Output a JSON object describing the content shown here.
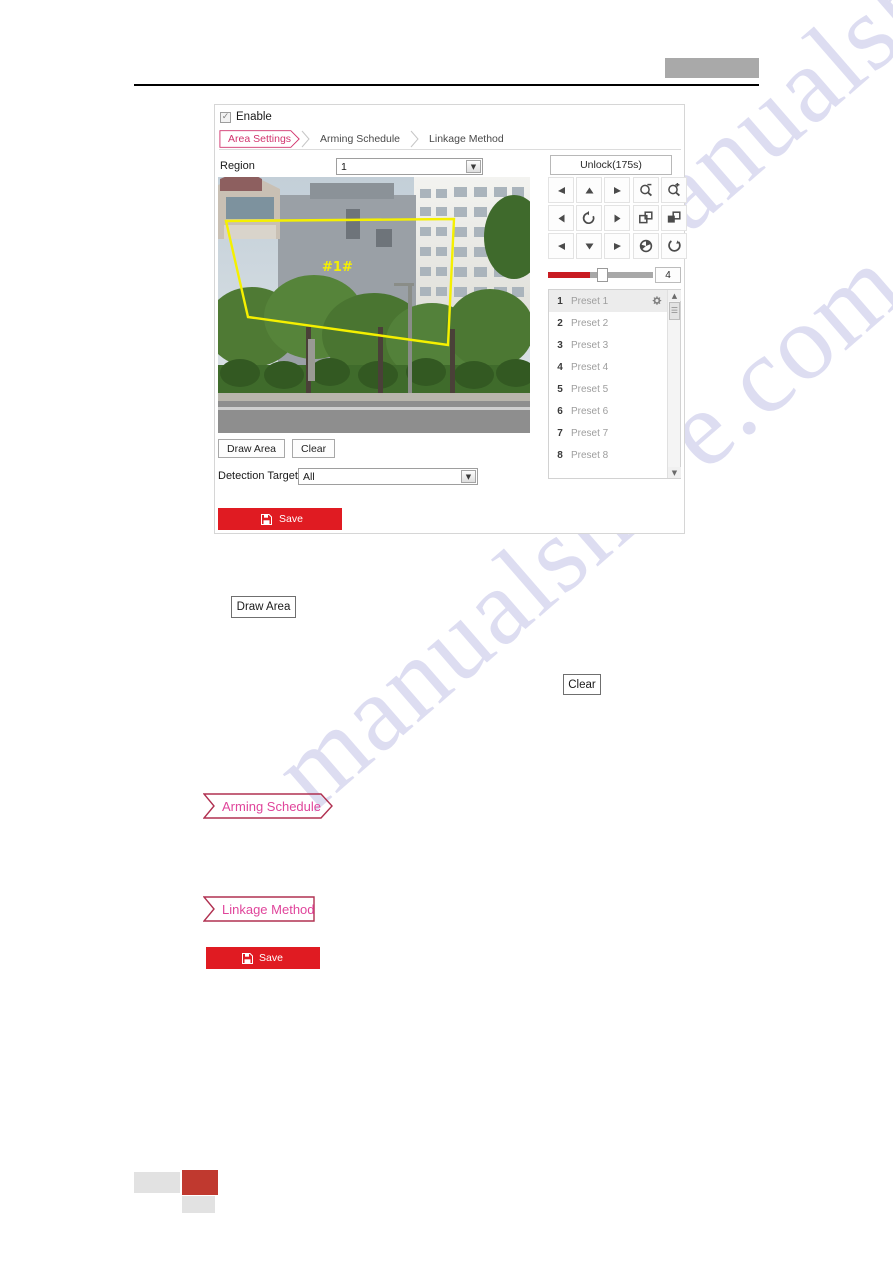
{
  "header": {
    "redacted_block": ""
  },
  "panel": {
    "enable": {
      "label": "Enable",
      "checked": true,
      "check_glyph": "✓"
    },
    "tabs": [
      {
        "label": "Area Settings",
        "active": true
      },
      {
        "label": "Arming Schedule",
        "active": false
      },
      {
        "label": "Linkage Method",
        "active": false
      }
    ],
    "region": {
      "label": "Region",
      "value": "1",
      "arrow_glyph": "▼"
    },
    "unlock_button": {
      "label": "Unlock(175s)"
    },
    "video": {
      "area_label": "#1#",
      "area_color": "#f5f000"
    },
    "draw_buttons": [
      {
        "label": "Draw Area"
      },
      {
        "label": "Clear"
      }
    ],
    "detection_target": {
      "label": "Detection Target",
      "value": "All",
      "arrow_glyph": "▼"
    },
    "save_button": {
      "label": "Save",
      "icon": "floppy-disk-icon"
    }
  },
  "ptz": {
    "direction_buttons": [
      {
        "name": "up-left",
        "glyph": "◤"
      },
      {
        "name": "up",
        "glyph": "▲"
      },
      {
        "name": "up-right",
        "glyph": "◥"
      },
      {
        "name": "left",
        "glyph": "◀"
      },
      {
        "name": "auto-scan",
        "glyph": "↺"
      },
      {
        "name": "right",
        "glyph": "▶"
      },
      {
        "name": "down-left",
        "glyph": "◣"
      },
      {
        "name": "down",
        "glyph": "▼"
      },
      {
        "name": "down-right",
        "glyph": "◢"
      }
    ],
    "lens_buttons": [
      {
        "name": "zoom-out",
        "glyph": "−"
      },
      {
        "name": "zoom-in",
        "glyph": "+"
      },
      {
        "name": "focus-near",
        "glyph": "−"
      },
      {
        "name": "focus-far",
        "glyph": "+"
      },
      {
        "name": "iris-close",
        "glyph": "−"
      },
      {
        "name": "iris-open",
        "glyph": "+"
      }
    ],
    "speed": {
      "value": "4",
      "fill_percent": 40,
      "accent": "#c81c22"
    },
    "presets": [
      {
        "num": "1",
        "name": "Preset 1",
        "selected": true
      },
      {
        "num": "2",
        "name": "Preset 2",
        "selected": false
      },
      {
        "num": "3",
        "name": "Preset 3",
        "selected": false
      },
      {
        "num": "4",
        "name": "Preset 4",
        "selected": false
      },
      {
        "num": "5",
        "name": "Preset 5",
        "selected": false
      },
      {
        "num": "6",
        "name": "Preset 6",
        "selected": false
      },
      {
        "num": "7",
        "name": "Preset 7",
        "selected": false
      },
      {
        "num": "8",
        "name": "Preset 8",
        "selected": false
      }
    ],
    "scroll_up_glyph": "▲",
    "scroll_down_glyph": "▼"
  },
  "callouts": {
    "draw_area": "Draw Area",
    "clear": "Clear",
    "arming_schedule": "Arming Schedule",
    "linkage_method": "Linkage Method",
    "save": "Save"
  },
  "watermark": {
    "text": "manualshive.com"
  },
  "colors": {
    "accent_red": "#e01b22",
    "tab_active": "#d1336d",
    "callout_pink": "#e0459b",
    "callout_outline": "#b03050"
  }
}
